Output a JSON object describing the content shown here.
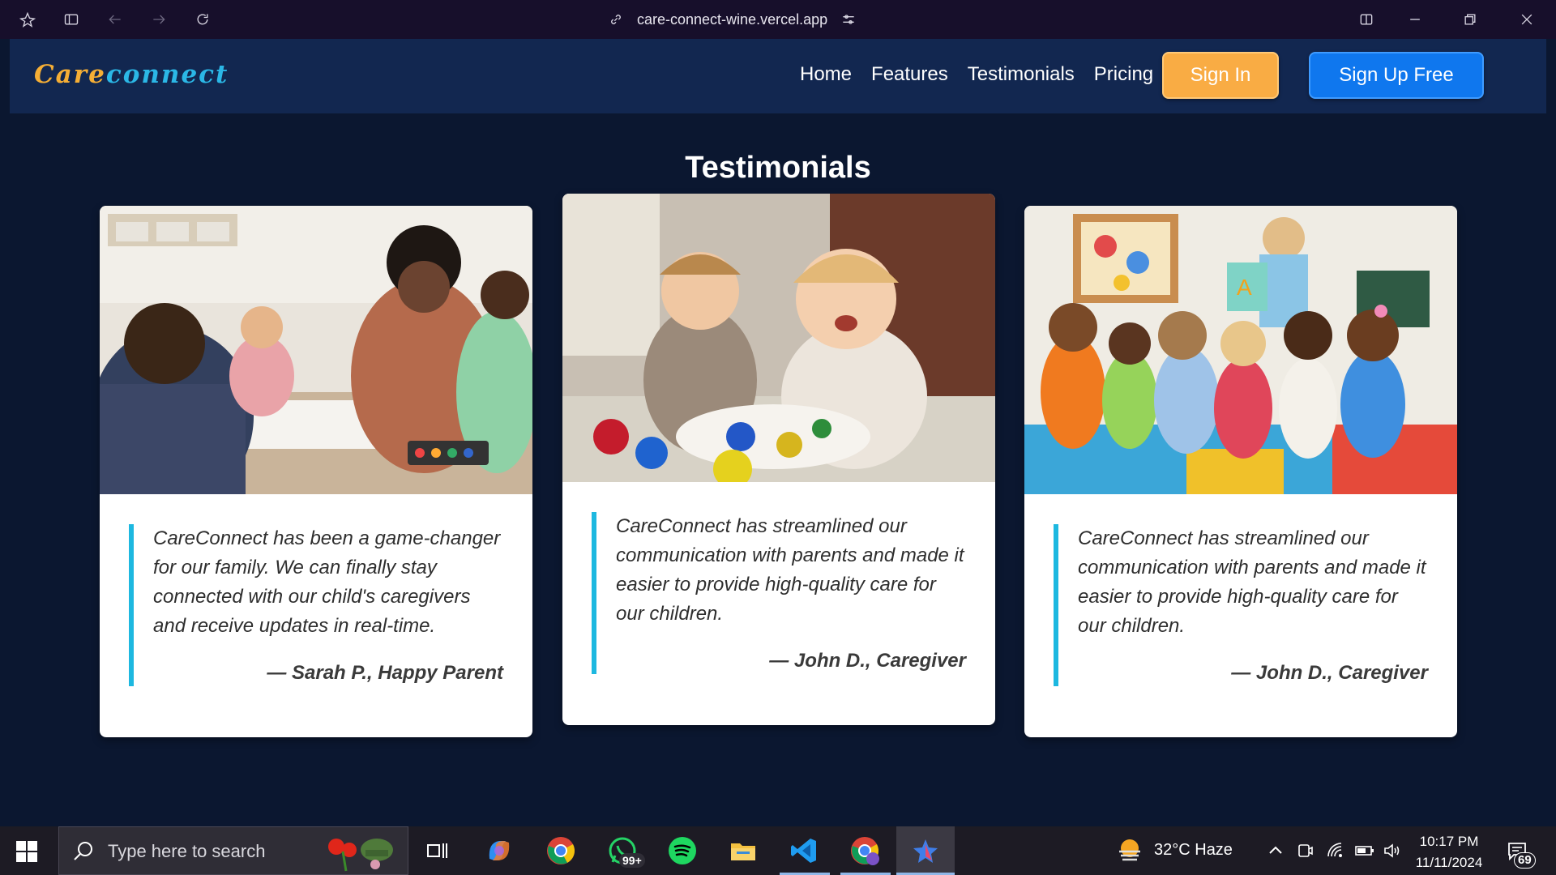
{
  "browser": {
    "url": "care-connect-wine.vercel.app"
  },
  "navbar": {
    "brand_part1": "Care",
    "brand_part2": "connect",
    "links": [
      "Home",
      "Features",
      "Testimonials",
      "Pricing"
    ],
    "signin_label": "Sign In",
    "signup_label": "Sign Up Free",
    "colors": {
      "signin": "#f9ac44",
      "signup": "#0f77ee",
      "background": "#122750"
    }
  },
  "testimonials": {
    "title": "Testimonials",
    "cards": [
      {
        "quote": "CareConnect has been a game-changer for our family. We can finally stay connected with our child's caregivers and receive updates in real-time.",
        "author": "— Sarah P., Happy Parent",
        "image": "teacher-high-five-children-photo"
      },
      {
        "quote": "CareConnect has streamlined our communication with parents and made it easier to provide high-quality care for our children.",
        "author": "— John D., Caregiver",
        "image": "toddlers-finger-painting-photo"
      },
      {
        "quote": "CareConnect has streamlined our communication with parents and made it easier to provide high-quality care for our children.",
        "author": "— John D., Caregiver",
        "image": "teacher-reading-to-children-photo"
      }
    ]
  },
  "taskbar": {
    "search_placeholder": "Type here to search",
    "whatsapp_badge": "99+",
    "weather": "32°C  Haze",
    "time": "10:17 PM",
    "date": "11/11/2024",
    "notifications": "69"
  }
}
